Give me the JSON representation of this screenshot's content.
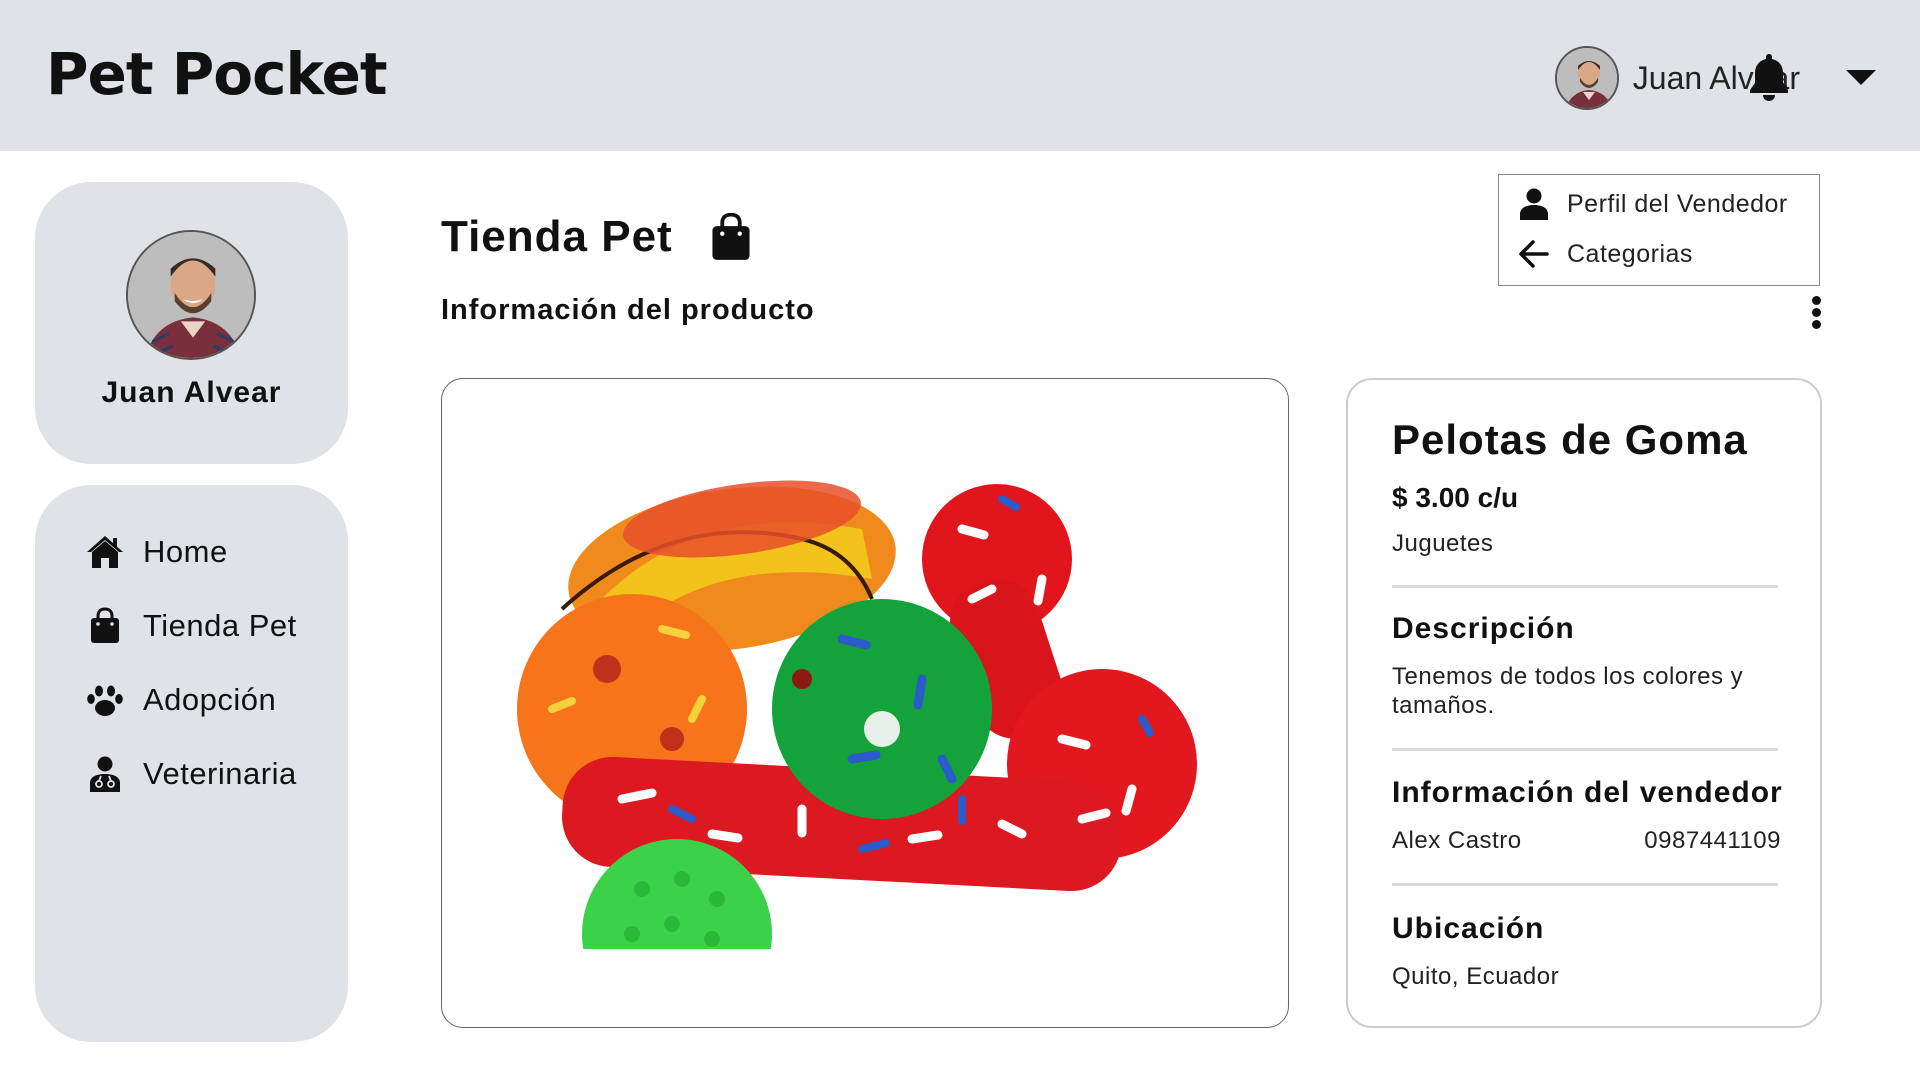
{
  "app": {
    "title": "Pet Pocket"
  },
  "header": {
    "user_name": "Juan Alvear"
  },
  "sidebar": {
    "profile_name": "Juan Alvear",
    "items": [
      {
        "label": "Home",
        "icon": "home-icon"
      },
      {
        "label": "Tienda Pet",
        "icon": "shopping-bag-icon"
      },
      {
        "label": "Adopción",
        "icon": "paw-icon"
      },
      {
        "label": "Veterinaria",
        "icon": "doctor-icon"
      }
    ]
  },
  "main": {
    "title": "Tienda Pet",
    "subtitle": "Información del producto"
  },
  "menu": {
    "items": [
      {
        "label": "Perfil del Vendedor",
        "icon": "user-icon"
      },
      {
        "label": "Categorias",
        "icon": "arrow-left-icon"
      }
    ]
  },
  "product": {
    "name": "Pelotas de Goma",
    "price": "$ 3.00 c/u",
    "category": "Juguetes",
    "description_heading": "Descripción",
    "description": "Tenemos de todos los colores y tamaños.",
    "seller_heading": "Información del vendedor",
    "seller_name": "Alex Castro",
    "seller_phone": "0987441109",
    "location_heading": "Ubicación",
    "location": "Quito, Ecuador",
    "image_alt": "Colorful rubber dog toys"
  },
  "colors": {
    "header_bg": "#dfe2e6",
    "sidebar_bg": "#dfe2e6"
  }
}
